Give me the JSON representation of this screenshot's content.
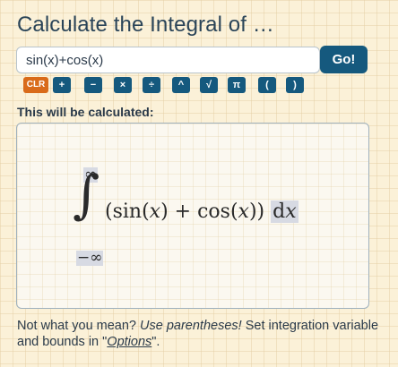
{
  "title": "Calculate the Integral of …",
  "input": {
    "value": "sin(x)+cos(x)"
  },
  "go_button": "Go!",
  "keys": [
    {
      "label": "CLR",
      "name": "clr-key"
    },
    {
      "label": "+",
      "name": "plus-key"
    },
    {
      "label": "−",
      "name": "minus-key"
    },
    {
      "label": "×",
      "name": "multiply-key"
    },
    {
      "label": "÷",
      "name": "divide-key"
    },
    {
      "label": "^",
      "name": "power-key"
    },
    {
      "label": "√",
      "name": "sqrt-key"
    },
    {
      "label": "π",
      "name": "pi-key"
    },
    {
      "label": "(",
      "name": "open-paren-key"
    },
    {
      "label": ")",
      "name": "close-paren-key"
    }
  ],
  "subtitle": "This will be calculated:",
  "preview": {
    "upper_bound": "∞",
    "lower_bound": "−∞",
    "integral_sign": "∫",
    "expression": {
      "open": "(sin(",
      "var1": "x",
      "mid": ") + cos(",
      "var2": "x",
      "close": "))",
      "d": "d",
      "dvar": "x"
    }
  },
  "footer": {
    "text1": "Not what you mean? ",
    "emphasis": "Use parentheses!",
    "text2": " Set integration variable and bounds in \"",
    "link": "Options",
    "text3": "\"."
  }
}
